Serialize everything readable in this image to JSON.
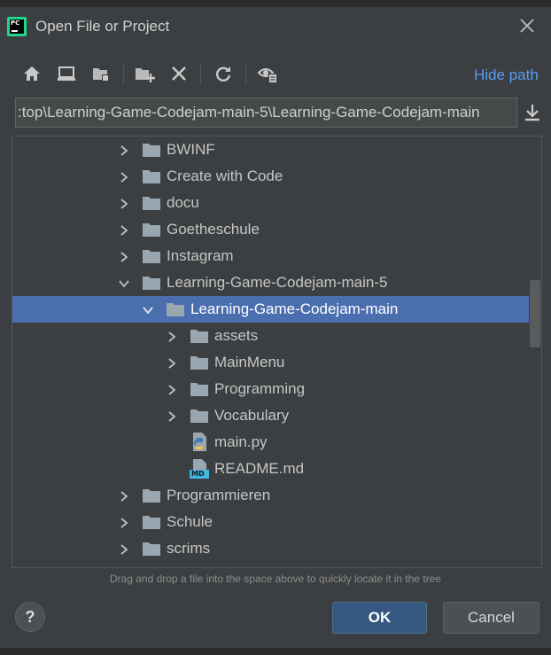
{
  "window": {
    "title": "Open File or Project",
    "app_icon": "pycharm-icon",
    "app_icon_text": "PC"
  },
  "toolbar": {
    "buttons": [
      {
        "name": "home-icon"
      },
      {
        "name": "desktop-icon"
      },
      {
        "name": "project-folder-icon"
      },
      {
        "name": "new-folder-icon"
      },
      {
        "name": "delete-icon"
      },
      {
        "name": "refresh-icon"
      },
      {
        "name": "show-hidden-icon"
      }
    ],
    "hide_path_label": "Hide path"
  },
  "path": {
    "value": ":top\\Learning-Game-Codejam-main-5\\Learning-Game-Codejam-main"
  },
  "tree": {
    "rows": [
      {
        "label": "BWINF",
        "type": "folder",
        "level": 0,
        "state": "collapsed",
        "selected": false
      },
      {
        "label": "Create with Code",
        "type": "folder",
        "level": 0,
        "state": "collapsed",
        "selected": false
      },
      {
        "label": "docu",
        "type": "folder",
        "level": 0,
        "state": "collapsed",
        "selected": false
      },
      {
        "label": "Goetheschule",
        "type": "folder",
        "level": 0,
        "state": "collapsed",
        "selected": false
      },
      {
        "label": "Instagram",
        "type": "folder",
        "level": 0,
        "state": "collapsed",
        "selected": false
      },
      {
        "label": "Learning-Game-Codejam-main-5",
        "type": "folder",
        "level": 0,
        "state": "expanded",
        "selected": false
      },
      {
        "label": "Learning-Game-Codejam-main",
        "type": "folder",
        "level": 1,
        "state": "expanded",
        "selected": true
      },
      {
        "label": "assets",
        "type": "folder",
        "level": 2,
        "state": "collapsed",
        "selected": false
      },
      {
        "label": "MainMenu",
        "type": "folder",
        "level": 2,
        "state": "collapsed",
        "selected": false
      },
      {
        "label": "Programming",
        "type": "folder",
        "level": 2,
        "state": "collapsed",
        "selected": false
      },
      {
        "label": "Vocabulary",
        "type": "folder",
        "level": 2,
        "state": "collapsed",
        "selected": false
      },
      {
        "label": "main.py",
        "type": "python",
        "level": 2,
        "state": "none",
        "selected": false
      },
      {
        "label": "README.md",
        "type": "markdown",
        "level": 2,
        "state": "none",
        "selected": false,
        "icon_text": "MD"
      },
      {
        "label": "Programmieren",
        "type": "folder",
        "level": 0,
        "state": "collapsed",
        "selected": false
      },
      {
        "label": "Schule",
        "type": "folder",
        "level": 0,
        "state": "collapsed",
        "selected": false
      },
      {
        "label": "scrims",
        "type": "folder",
        "level": 0,
        "state": "collapsed",
        "selected": false
      }
    ]
  },
  "hint": "Drag and drop a file into the space above to quickly locate it in the tree",
  "buttons": {
    "help": "?",
    "ok": "OK",
    "cancel": "Cancel"
  },
  "colors": {
    "background": "#3c3f41",
    "selection": "#4b6eaf",
    "link": "#589df6",
    "folder": "#9aa7b0",
    "primary_button": "#365880"
  }
}
